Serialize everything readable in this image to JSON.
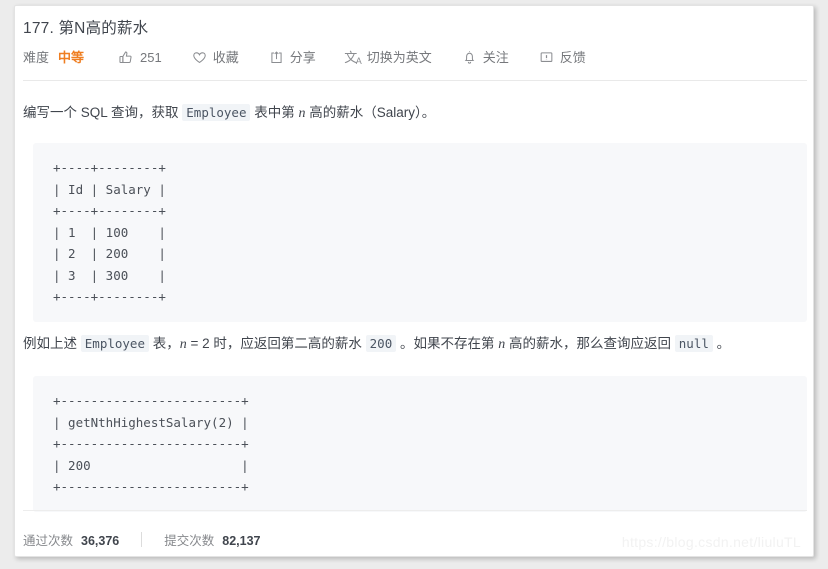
{
  "header": {
    "title": "177. 第N高的薪水",
    "toolbar": {
      "difficulty_label": "难度",
      "difficulty_value": "中等",
      "difficulty_color": "#ef7e21",
      "like_count": "251",
      "favorite_label": "收藏",
      "share_label": "分享",
      "translate_label": "切换为英文",
      "follow_label": "关注",
      "feedback_label": "反馈"
    }
  },
  "content": {
    "paragraph1": {
      "part1": "编写一个 SQL 查询，获取 ",
      "code1": "Employee",
      "part2": " 表中第 ",
      "var1": "n",
      "part3": " 高的薪水（Salary）。"
    },
    "code_block_1": "+----+--------+\n| Id | Salary |\n+----+--------+\n| 1  | 100    |\n| 2  | 200    |\n| 3  | 300    |\n+----+--------+",
    "paragraph2": {
      "part1": "例如上述 ",
      "code1": "Employee",
      "part2": " 表，",
      "var1": "n",
      "part3": " = 2 时，应返回第二高的薪水 ",
      "code2": "200",
      "part4": " 。如果不存在第 ",
      "var2": "n",
      "part5": " 高的薪水，那么查询应返回 ",
      "code3": "null",
      "part6": " 。"
    },
    "code_block_2": "+------------------------+\n| getNthHighestSalary(2) |\n+------------------------+\n| 200                    |\n+------------------------+"
  },
  "footer": {
    "accepted_label": "通过次数",
    "accepted_value": "36,376",
    "submitted_label": "提交次数",
    "submitted_value": "82,137"
  },
  "watermark": "https://blog.csdn.net/liuluTL"
}
